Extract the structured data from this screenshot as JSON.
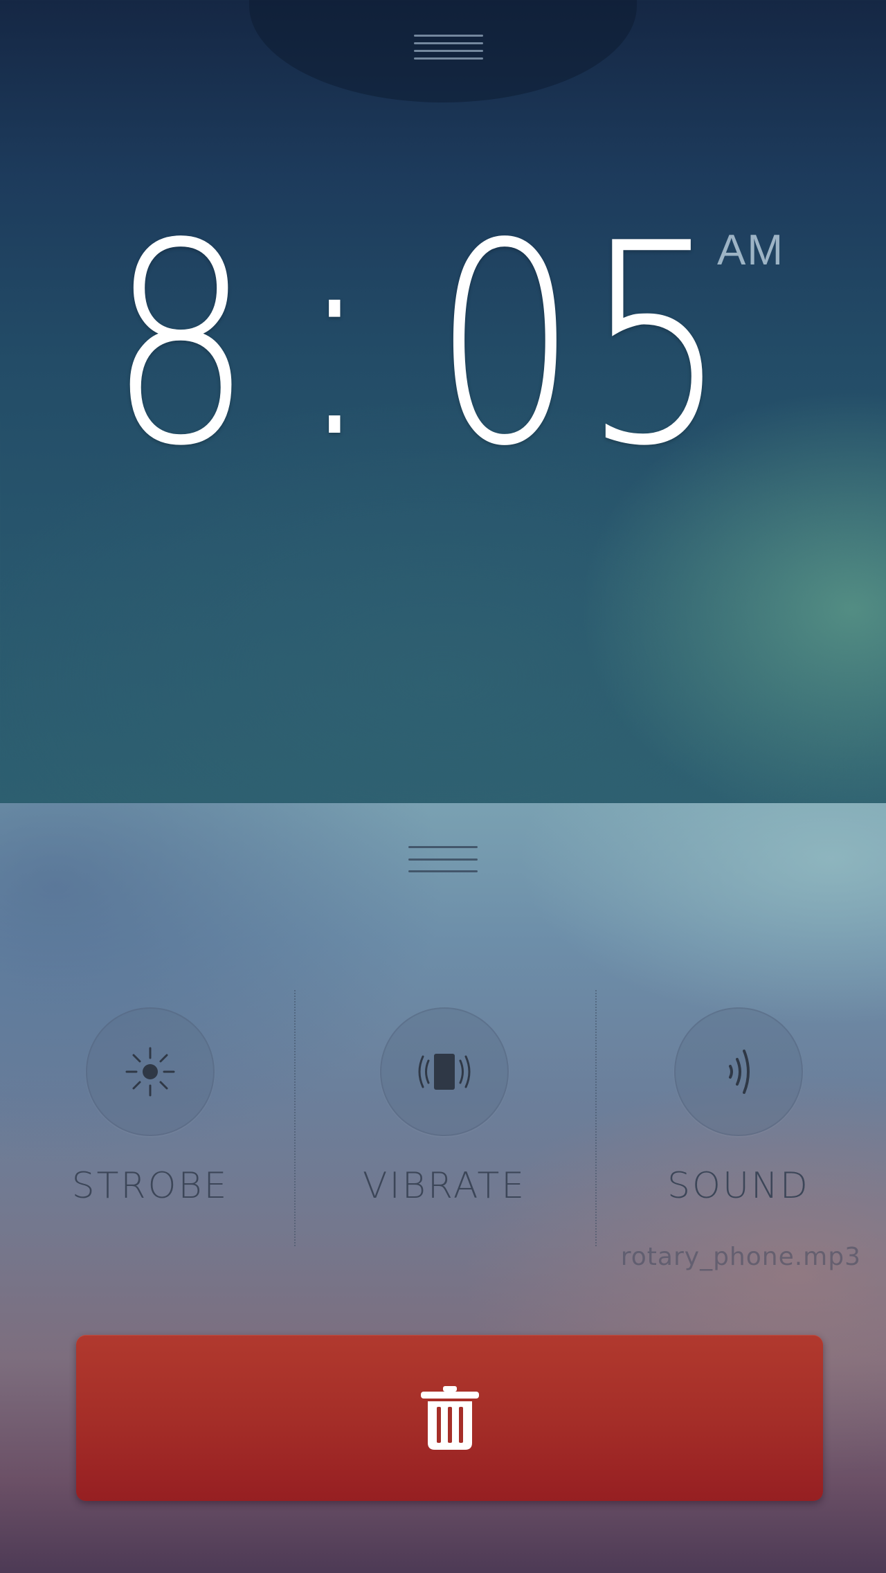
{
  "clock": {
    "hour": "8",
    "separator": ":",
    "minutes": "05",
    "period": "AM"
  },
  "options": [
    {
      "label": "STROBE",
      "icon": "sun-icon"
    },
    {
      "label": "VIBRATE",
      "icon": "vibrate-phone-icon"
    },
    {
      "label": "SOUND",
      "icon": "sound-waves-icon"
    }
  ],
  "sound_file": "rotary_phone.mp3",
  "delete_button": {
    "icon": "trash-icon"
  },
  "colors": {
    "delete": "#a52e28",
    "clock_text": "#ffffff",
    "label_text": "#3c4658"
  }
}
